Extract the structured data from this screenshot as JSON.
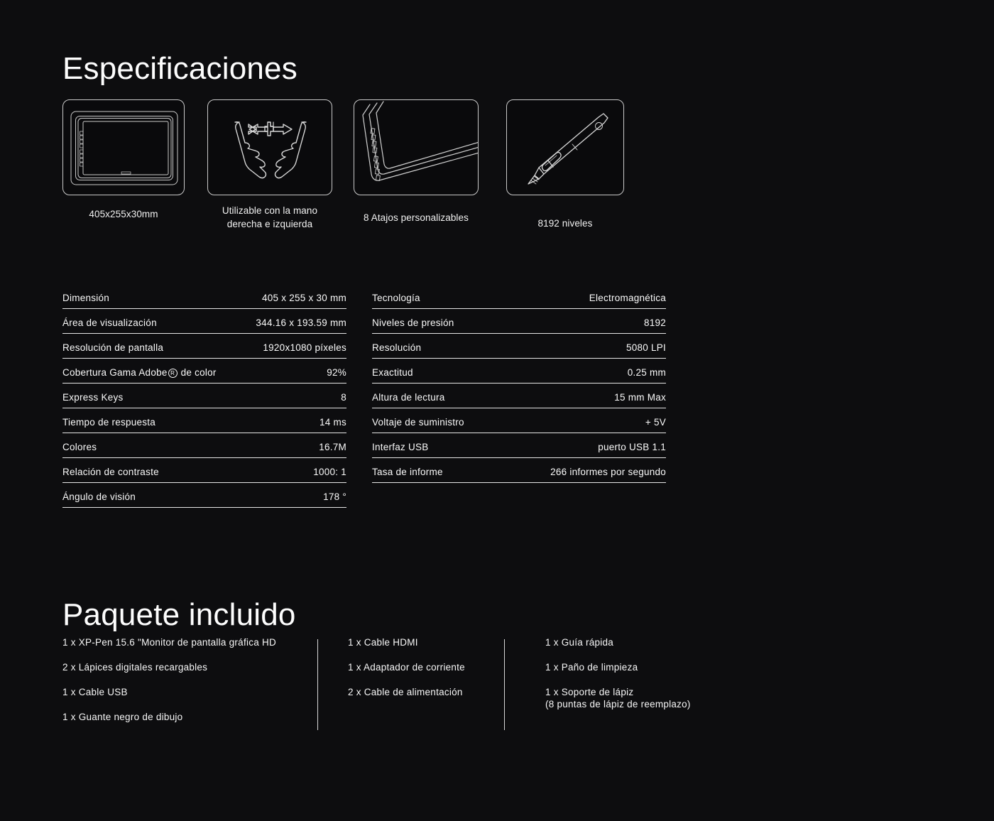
{
  "theme": {
    "background": "#0d0d0f",
    "text": "#ffffff",
    "rule": "#e6e6e6",
    "icon_stroke": "#c9c9c9"
  },
  "sections": {
    "specs_title": "Especificaciones",
    "package_title": "Paquete incluido"
  },
  "features": [
    {
      "icon": "graphic-tablet-front-icon",
      "caption": "405x255x30mm"
    },
    {
      "icon": "both-hands-arrows-icon",
      "caption": "Utilizable con la mano\nderecha e izquierda"
    },
    {
      "icon": "tablet-express-keys-corner-icon",
      "caption": "8 Atajos personalizables"
    },
    {
      "icon": "stylus-pen-icon",
      "caption": "8192 niveles"
    }
  ],
  "spec_table_left": {
    "rows": [
      {
        "label": "Dimensión",
        "value": "405 x 255 x 30 mm"
      },
      {
        "label": "Área de visualización",
        "value": "344.16 x 193.59 mm"
      },
      {
        "label": "Resolución de pantalla",
        "value": "1920x1080 píxeles"
      },
      {
        "label": "Cobertura Gama Adobe® de color",
        "value": "92%"
      },
      {
        "label": "Express Keys",
        "value": "8"
      },
      {
        "label": "Tiempo de respuesta",
        "value": "14 ms"
      },
      {
        "label": "Colores",
        "value": "16.7M"
      },
      {
        "label": "Relación de contraste",
        "value": "1000: 1"
      },
      {
        "label": "Ángulo de visión",
        "value": "178 °"
      }
    ]
  },
  "spec_table_right": {
    "rows": [
      {
        "label": "Tecnología",
        "value": "Electromagnética"
      },
      {
        "label": "Niveles de presión",
        "value": "8192"
      },
      {
        "label": "Resolución",
        "value": "5080 LPI"
      },
      {
        "label": "Exactitud",
        "value": "0.25 mm"
      },
      {
        "label": "Altura de lectura",
        "value": "15 mm Max"
      },
      {
        "label": "Voltaje de suministro",
        "value": "+ 5V"
      },
      {
        "label": "Interfaz USB",
        "value": "puerto USB 1.1"
      },
      {
        "label": "Tasa de informe",
        "value": "266 informes por segundo"
      }
    ]
  },
  "package_columns": [
    {
      "items": [
        "1 x XP-Pen 15.6 \"Monitor de pantalla gráfica HD",
        "2 x Lápices digitales recargables",
        "1 x Cable USB",
        "1 x Guante negro de dibujo"
      ]
    },
    {
      "items": [
        "1 x Cable HDMI",
        "1 x Adaptador de corriente",
        "2 x Cable de alimentación"
      ]
    },
    {
      "items": [
        "1 x Guía rápida",
        "1 x Paño de limpieza",
        "1 x Soporte de lápiz\n(8 puntas de lápiz de reemplazo)"
      ]
    }
  ]
}
